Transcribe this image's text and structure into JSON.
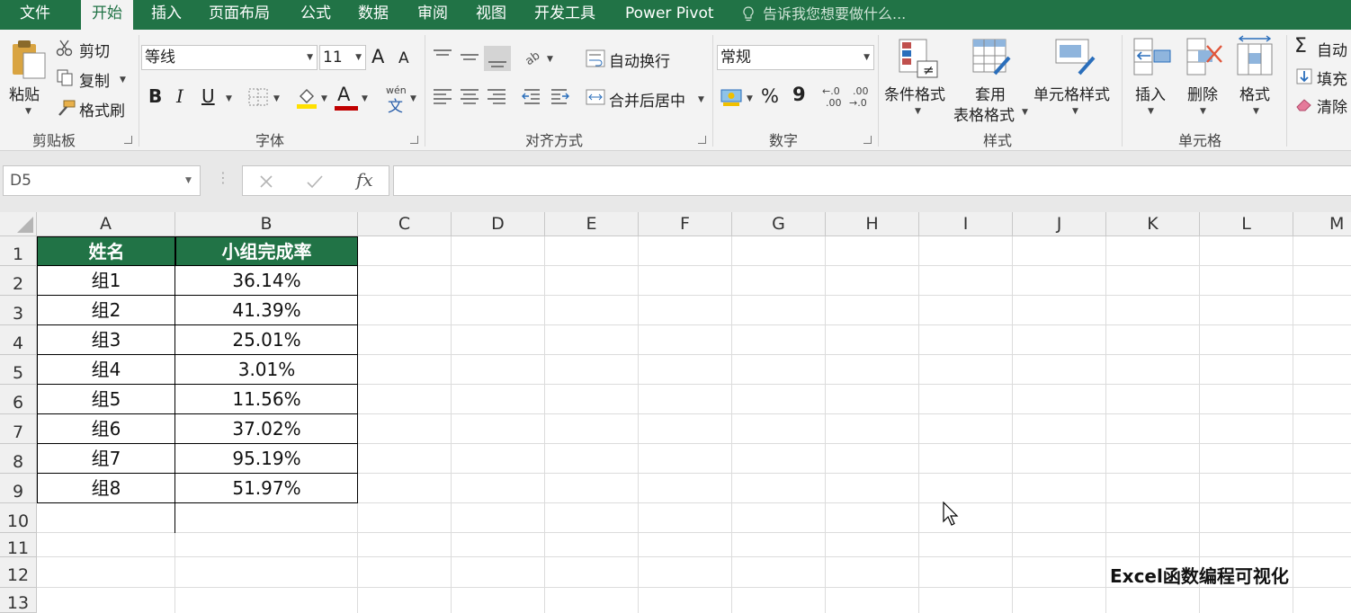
{
  "menu": {
    "tabs": [
      "文件",
      "开始",
      "插入",
      "页面布局",
      "公式",
      "数据",
      "审阅",
      "视图",
      "开发工具",
      "Power Pivot"
    ],
    "active_tab": "开始",
    "tell_me": "告诉我您想要做什么..."
  },
  "ribbon": {
    "clipboard": {
      "paste": "粘贴",
      "cut": "剪切",
      "copy": "复制",
      "format_painter": "格式刷",
      "label": "剪贴板"
    },
    "font": {
      "font_name": "等线",
      "font_size": "11",
      "grow": "A",
      "shrink": "A",
      "bold": "B",
      "italic": "I",
      "underline": "U",
      "font_color": "A",
      "phonetic_top": "wén",
      "phonetic_bottom": "文",
      "label": "字体"
    },
    "alignment": {
      "wrap_text": "自动换行",
      "merge_center": "合并后居中",
      "label": "对齐方式"
    },
    "number": {
      "format": "常规",
      "percent": "%",
      "comma": "9",
      "inc_top": "←.0",
      "inc_bottom": ".00",
      "dec_top": ".00",
      "dec_bottom": "→.0",
      "label": "数字"
    },
    "styles": {
      "conditional": "条件格式",
      "table_line1": "套用",
      "table_line2": "表格格式",
      "cell_styles": "单元格样式",
      "label": "样式"
    },
    "cells": {
      "insert": "插入",
      "delete": "删除",
      "format": "格式",
      "label": "单元格"
    },
    "editing": {
      "autosum": "自动",
      "fill": "填充",
      "clear": "清除"
    }
  },
  "formula_bar": {
    "name_box": "D5",
    "fx": "fx",
    "formula": ""
  },
  "columns": [
    "A",
    "B",
    "C",
    "D",
    "E",
    "F",
    "G",
    "H",
    "I",
    "J",
    "K",
    "L",
    "M"
  ],
  "rows": [
    "1",
    "2",
    "3",
    "4",
    "5",
    "6",
    "7",
    "8",
    "9",
    "10",
    "11",
    "12",
    "13"
  ],
  "table": {
    "headers": [
      "姓名",
      "小组完成率"
    ],
    "rows": [
      [
        "组1",
        "36.14%"
      ],
      [
        "组2",
        "41.39%"
      ],
      [
        "组3",
        "25.01%"
      ],
      [
        "组4",
        "3.01%"
      ],
      [
        "组5",
        "11.56%"
      ],
      [
        "组6",
        "37.02%"
      ],
      [
        "组7",
        "95.19%"
      ],
      [
        "组8",
        "51.97%"
      ]
    ]
  },
  "watermark": "Excel函数编程可视化",
  "colors": {
    "excel_green": "#217346",
    "ribbon_bg": "#f3f3f3"
  }
}
